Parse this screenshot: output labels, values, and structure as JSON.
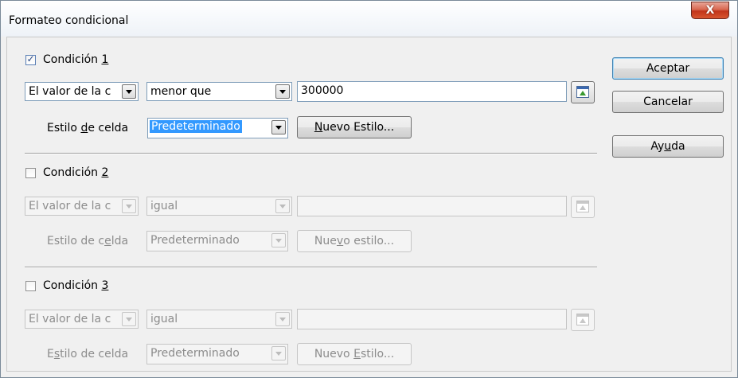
{
  "window": {
    "title": "Formateo condicional",
    "close_label": "X"
  },
  "conditions": [
    {
      "label_pre": "Condición ",
      "label_key": "1",
      "label_post": "",
      "checked": true,
      "type_value": "El valor de la c",
      "operator_value": "menor que",
      "value": "300000",
      "style_label_pre": "Estilo ",
      "style_label_key": "d",
      "style_label_post": "e celda",
      "style_value": "Predeterminado",
      "new_style_pre": "",
      "new_style_key": "N",
      "new_style_post": "uevo Estilo..."
    },
    {
      "label_pre": "Condición ",
      "label_key": "2",
      "label_post": "",
      "checked": false,
      "type_value": "El valor de la c",
      "operator_value": "igual",
      "value": "",
      "style_label_pre": "Estilo de c",
      "style_label_key": "e",
      "style_label_post": "lda",
      "style_value": "Predeterminado",
      "new_style_pre": "Nue",
      "new_style_key": "v",
      "new_style_post": "o estilo..."
    },
    {
      "label_pre": "Condición ",
      "label_key": "3",
      "label_post": "",
      "checked": false,
      "type_value": "El valor de la c",
      "operator_value": "igual",
      "value": "",
      "style_label_pre": "E",
      "style_label_key": "s",
      "style_label_post": "tilo de celda",
      "style_value": "Predeterminado",
      "new_style_pre": "Nuevo ",
      "new_style_key": "E",
      "new_style_post": "stilo..."
    }
  ],
  "buttons": {
    "ok": "Aceptar",
    "cancel": "Cancelar",
    "help_pre": "Ay",
    "help_key": "u",
    "help_post": "da"
  },
  "icons": {
    "check": "checkmark-icon",
    "dropdown": "chevron-down-icon",
    "shrink": "shrink-dialog-icon"
  }
}
